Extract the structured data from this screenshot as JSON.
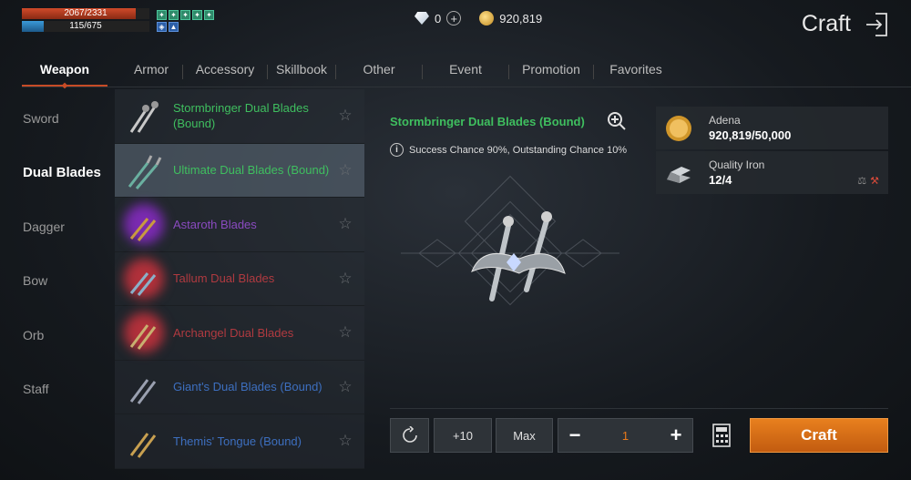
{
  "status": {
    "hp": "2067/2331",
    "hp_fraction": 0.887,
    "mp": "115/675",
    "mp_fraction": 0.17,
    "buff_icons": [
      "buff-icon",
      "buff-icon",
      "buff-icon",
      "buff-icon",
      "buff-icon",
      "shield-icon",
      "arrow-up-icon"
    ]
  },
  "currency": {
    "diamonds": "0",
    "gold": "920,819"
  },
  "header": {
    "title": "Craft"
  },
  "tabs": [
    "Weapon",
    "Armor",
    "Accessory",
    "Skillbook",
    "Other",
    "Event",
    "Promotion",
    "Favorites"
  ],
  "categories": [
    "Sword",
    "Dual Blades",
    "Dagger",
    "Bow",
    "Orb",
    "Staff"
  ],
  "items": [
    {
      "name": "Stormbringer Dual Blades (Bound)",
      "grade": "green"
    },
    {
      "name": "Ultimate Dual Blades (Bound)",
      "grade": "green"
    },
    {
      "name": "Astaroth Blades",
      "grade": "purple"
    },
    {
      "name": "Tallum Dual Blades",
      "grade": "red"
    },
    {
      "name": "Archangel Dual Blades",
      "grade": "red"
    },
    {
      "name": "Giant's Dual Blades (Bound)",
      "grade": "blue"
    },
    {
      "name": "Themis' Tongue (Bound)",
      "grade": "blue"
    }
  ],
  "detail": {
    "title": "Stormbringer Dual Blades (Bound)",
    "chance": "Success Chance 90%, Outstanding Chance 10%"
  },
  "materials": [
    {
      "label": "Adena",
      "value": "920,819/50,000"
    },
    {
      "label": "Quality Iron",
      "value": "12/4"
    }
  ],
  "controls": {
    "plus10": "+10",
    "max": "Max",
    "quantity": "1",
    "craft": "Craft"
  },
  "colors": {
    "accent": "#e8801e",
    "green": "#3fbf5f",
    "purple": "#8a4ac0",
    "red": "#b03a40",
    "blue": "#3d6fbf"
  }
}
